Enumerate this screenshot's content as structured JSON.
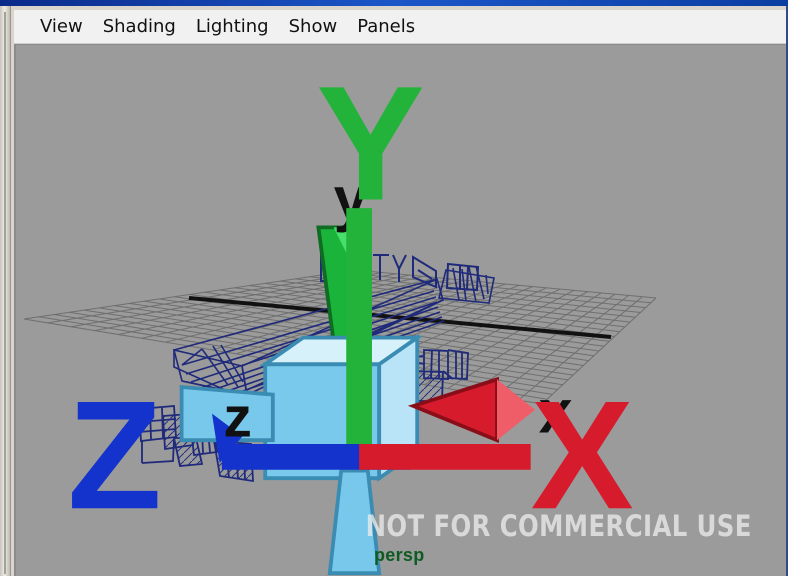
{
  "menu": {
    "items": [
      {
        "label": "View"
      },
      {
        "label": "Shading"
      },
      {
        "label": "Lighting"
      },
      {
        "label": "Show"
      },
      {
        "label": "Panels"
      }
    ]
  },
  "viewport": {
    "camera_name": "persp",
    "watermark": "NOT FOR COMMERCIAL USE",
    "view_cube_axes": {
      "y": "y",
      "x": "x",
      "z": "z"
    },
    "axis_indicator": {
      "y": "Y",
      "z": "Z",
      "x": "X"
    },
    "colors": {
      "grid": "#6f6f6f",
      "wireframe": "#1f2a7a",
      "x_axis": "#d61b2d",
      "y_axis": "#23b33a",
      "z_axis": "#1333cc",
      "camera_label": "#0e5c22",
      "cube": "#78c8eb"
    }
  }
}
